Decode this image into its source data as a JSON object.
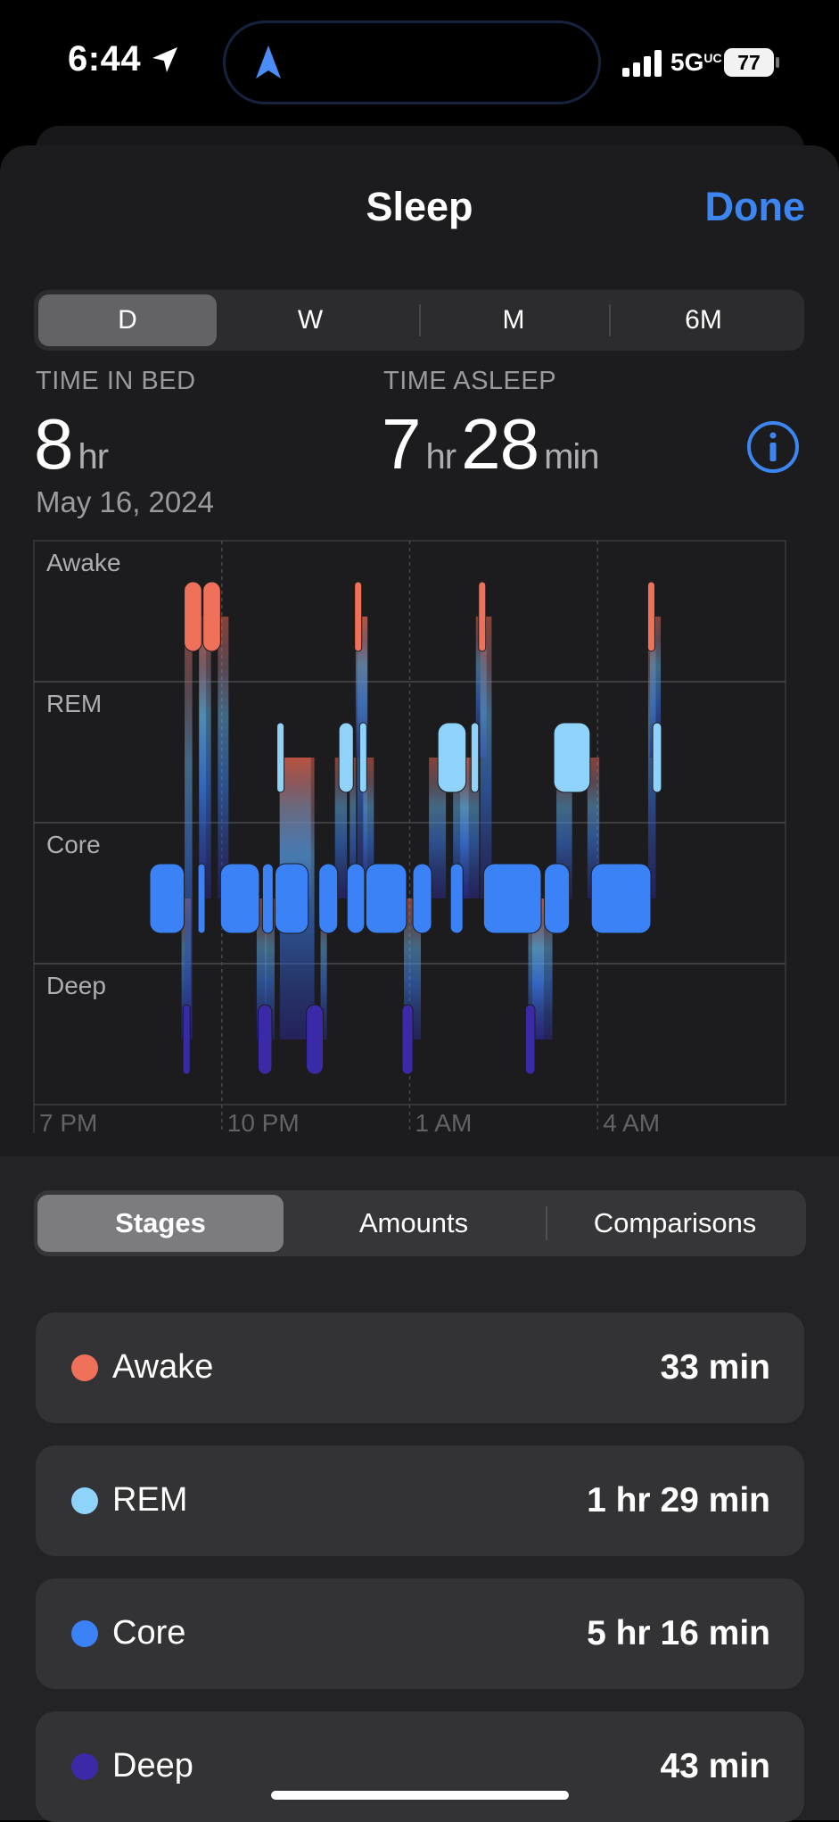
{
  "status_bar": {
    "time": "6:44",
    "network": "5G",
    "network_suffix": "UC",
    "battery": "77"
  },
  "nav": {
    "title": "Sleep",
    "done": "Done"
  },
  "range_tabs": [
    "D",
    "W",
    "M",
    "6M"
  ],
  "range_selected": "D",
  "summary": {
    "time_in_bed_label": "TIME IN BED",
    "time_in_bed_value": "8",
    "time_in_bed_unit": "hr",
    "time_asleep_label": "TIME ASLEEP",
    "time_asleep_hr": "7",
    "time_asleep_hr_unit": "hr",
    "time_asleep_min": "28",
    "time_asleep_min_unit": "min",
    "date": "May 16, 2024"
  },
  "view_tabs": [
    "Stages",
    "Amounts",
    "Comparisons"
  ],
  "view_selected": "Stages",
  "stages": [
    {
      "name": "Awake",
      "value": "33 min",
      "color": "#f0715a"
    },
    {
      "name": "REM",
      "value": "1 hr 29 min",
      "color": "#8fd3fb"
    },
    {
      "name": "Core",
      "value": "5 hr 16 min",
      "color": "#3a82f6"
    },
    {
      "name": "Deep",
      "value": "43 min",
      "color": "#3b2aa8"
    }
  ],
  "chart_data": {
    "type": "timeline",
    "stage_rows": [
      "Awake",
      "REM",
      "Core",
      "Deep"
    ],
    "x_tick_labels": [
      "7 PM",
      "10 PM",
      "1 AM",
      "4 AM"
    ],
    "x_unit": "hours since 7 PM",
    "segments": [
      {
        "stage": "Core",
        "start": 1.85,
        "end": 2.4
      },
      {
        "stage": "Deep",
        "start": 2.38,
        "end": 2.45
      },
      {
        "stage": "Awake",
        "start": 2.4,
        "end": 2.68
      },
      {
        "stage": "Core",
        "start": 2.62,
        "end": 2.68
      },
      {
        "stage": "Awake",
        "start": 2.7,
        "end": 2.98
      },
      {
        "stage": "Core",
        "start": 2.98,
        "end": 3.6
      },
      {
        "stage": "Deep",
        "start": 3.58,
        "end": 3.8
      },
      {
        "stage": "Core",
        "start": 3.65,
        "end": 3.82
      },
      {
        "stage": "Core",
        "start": 3.85,
        "end": 4.38
      },
      {
        "stage": "REM",
        "start": 3.88,
        "end": 3.97
      },
      {
        "stage": "Deep",
        "start": 4.35,
        "end": 4.62
      },
      {
        "stage": "Core",
        "start": 4.55,
        "end": 4.85
      },
      {
        "stage": "REM",
        "start": 4.87,
        "end": 5.1
      },
      {
        "stage": "Awake",
        "start": 5.12,
        "end": 5.18
      },
      {
        "stage": "REM",
        "start": 5.2,
        "end": 5.3
      },
      {
        "stage": "Core",
        "start": 5.0,
        "end": 5.28
      },
      {
        "stage": "Core",
        "start": 5.3,
        "end": 5.95
      },
      {
        "stage": "Deep",
        "start": 5.88,
        "end": 6.05
      },
      {
        "stage": "Core",
        "start": 6.05,
        "end": 6.35
      },
      {
        "stage": "REM",
        "start": 6.45,
        "end": 6.9
      },
      {
        "stage": "Core",
        "start": 6.65,
        "end": 6.85
      },
      {
        "stage": "REM",
        "start": 6.98,
        "end": 7.1
      },
      {
        "stage": "Awake",
        "start": 7.1,
        "end": 7.17
      },
      {
        "stage": "Core",
        "start": 7.18,
        "end": 8.1
      },
      {
        "stage": "Deep",
        "start": 7.85,
        "end": 8.0
      },
      {
        "stage": "Core",
        "start": 8.15,
        "end": 8.55
      },
      {
        "stage": "REM",
        "start": 8.3,
        "end": 8.88
      },
      {
        "stage": "Core",
        "start": 8.9,
        "end": 9.85
      },
      {
        "stage": "Awake",
        "start": 9.8,
        "end": 9.88
      },
      {
        "stage": "REM",
        "start": 9.88,
        "end": 10.02
      }
    ],
    "grid": true
  }
}
